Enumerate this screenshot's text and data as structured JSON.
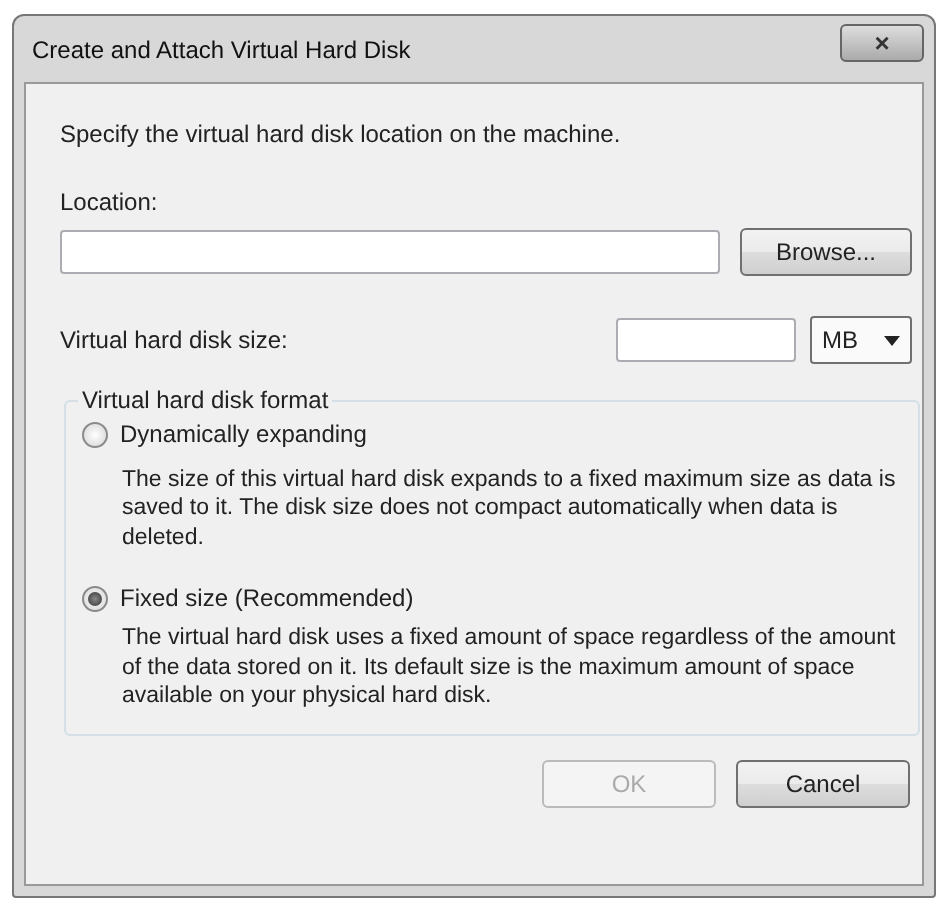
{
  "window": {
    "title": "Create and Attach Virtual Hard Disk",
    "close": "×"
  },
  "intro": "Specify the virtual hard disk location on the machine.",
  "location": {
    "label": "Location:",
    "browse": "Browse..."
  },
  "size": {
    "label": "Virtual hard disk size:",
    "unit": "MB"
  },
  "format": {
    "legend": "Virtual hard disk format",
    "options": [
      {
        "label": "Dynamically expanding",
        "selected": false,
        "description": "The size of this virtual hard disk expands to a fixed maximum size as data is saved to it.  The disk size does not compact automatically when data is deleted."
      },
      {
        "label": "Fixed size (Recommended)",
        "selected": true,
        "description": "The virtual hard disk uses a fixed amount of space regardless of the amount of the data stored on it.  Its default size is the maximum amount of space available on your physical hard disk."
      }
    ]
  },
  "buttons": [
    {
      "label": "OK",
      "disabled": true
    },
    {
      "label": "Cancel",
      "disabled": false
    }
  ]
}
